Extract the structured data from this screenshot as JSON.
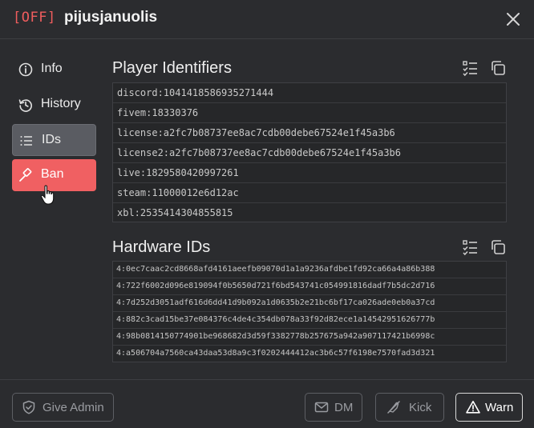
{
  "header": {
    "status": "[OFF]",
    "player_name": "pijusjanuolis"
  },
  "nav": [
    {
      "label": "Info",
      "icon": "info-icon"
    },
    {
      "label": "History",
      "icon": "history-icon"
    },
    {
      "label": "IDs",
      "icon": "list-icon"
    },
    {
      "label": "Ban",
      "icon": "gavel-icon"
    }
  ],
  "identifiers": {
    "title": "Player Identifiers",
    "items": [
      "discord:1041418586935271444",
      "fivem:18330376",
      "license:a2fc7b08737ee8ac7cdb00debe67524e1f45a3b6",
      "license2:a2fc7b08737ee8ac7cdb00debe67524e1f45a3b6",
      "live:1829580420997261",
      "steam:11000012e6d12ac",
      "xbl:2535414304855815"
    ]
  },
  "hardware": {
    "title": "Hardware IDs",
    "items": [
      "4:0ec7caac2cd8668afd4161aeefb09070d1a1a9236afdbe1fd92ca66a4a86b388",
      "4:722f6002d096e819094f0b5650d721f6bd543741c054991816dadf7b5dc2d716",
      "4:7d252d3051adf616d6dd41d9b092a1d0635b2e21bc6bf17ca026ade0eb0a37cd",
      "4:882c3cad15be37e084376c4de4c354db078a33f92d82ece1a14542951626777b",
      "4:98b0814150774901be968682d3d59f3382778b257675a942a907117421b6998c",
      "4:a506704a7560ca43daa53d8a9c3f0202444412ac3b6c57f6198e7570fad3d321"
    ]
  },
  "footer": {
    "give_admin": "Give Admin",
    "dm": "DM",
    "kick": "Kick",
    "warn": "Warn"
  },
  "colors": {
    "accent_red": "#f06062",
    "background": "#2b2c2f",
    "status_red": "#f05d5e"
  }
}
